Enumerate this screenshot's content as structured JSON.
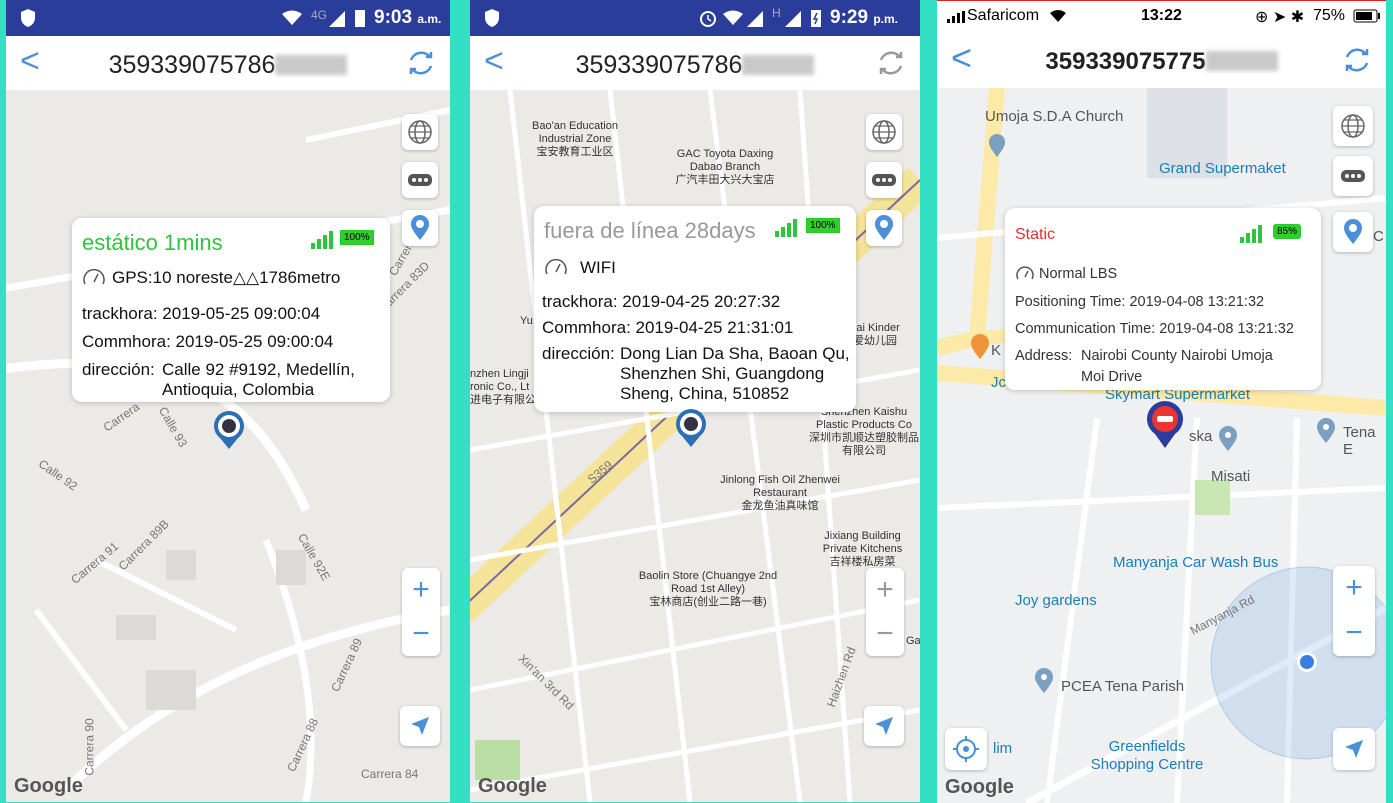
{
  "panels": [
    {
      "status": {
        "time": "9:03",
        "ampm": "a.m.",
        "network": "4G"
      },
      "header": {
        "back": "<",
        "title": "359339075786"
      },
      "popup": {
        "status": "estático 1mins",
        "battery": "100%",
        "line1": "GPS:10 noreste△△1786metro",
        "track": "trackhora: 2019-05-25 09:00:04",
        "comm": "Commhora: 2019-05-25 09:00:04",
        "addr_label": "dirección:",
        "addr_1": "Calle 92 #9192, Medellín,",
        "addr_2": "Antioquia, Colombia"
      },
      "streets": [
        "Carrera",
        "Calle 93",
        "Calle 92",
        "Carrera 91",
        "Carrera 89B",
        "Calle 92E",
        "Carrera 89",
        "Carrera 88",
        "Carrera 90",
        "Carrera 84",
        "Carrera 83D",
        "Carrera 84d"
      ],
      "google": "Google",
      "colors": {
        "status": "#2ec43c"
      }
    },
    {
      "status": {
        "time": "9:29",
        "ampm": "p.m.",
        "network": "H"
      },
      "header": {
        "back": "<",
        "title": "359339075786"
      },
      "popup": {
        "status": "fuera de línea 28days",
        "battery": "100%",
        "line1": "WIFI",
        "track": "trackhora: 2019-04-25 20:27:32",
        "comm": "Commhora: 2019-04-25 21:31:01",
        "addr_label": "dirección:",
        "addr_1": "Dong Lian Da Sha, Baoan Qu,",
        "addr_2": "Shenzhen Shi, Guangdong",
        "addr_3": "Sheng, China, 510852"
      },
      "places": {
        "baoan": "Bao'an Education Industrial Zone",
        "baoan_cn": "宝安教育工业区",
        "gac": "GAC Toyota Daxing Dabao Branch",
        "gac_cn": "广汽丰田大兴大宝店",
        "kinder": "ng'ai Kinder",
        "kinder_cn": "恒爱幼儿园",
        "lingji": "nzhen Lingji ronic Co., Lt",
        "lingji_cn": "进电子有限公司",
        "kaishu": "Shenzhen Kaishu Plastic Products Co",
        "kaishu_cn": "深圳市凯顺达塑胶制品有限公司",
        "jinlong": "Jinlong Fish Oil Zhenwei Restaurant",
        "jinlong_cn": "金龙鱼油真味馆",
        "jixiang": "Jixiang Building Private Kitchens",
        "jixiang_cn": "吉祥楼私房菜",
        "baolin": "Baolin Store (Chuangye 2nd Road 1st Alley)",
        "baolin_cn": "宝林商店(创业二路一巷)",
        "ga": "Ga",
        "road_s359": "S359",
        "xinan": "Xin'an 3rd Rd",
        "haizhen": "Haizhen Rd",
        "yu": "Yu"
      },
      "google": "Google",
      "colors": {
        "status": "#999999"
      }
    },
    {
      "status": {
        "carrier": "Safaricom",
        "time": "13:22",
        "battery": "75%"
      },
      "header": {
        "back": "<",
        "title": "359339075775"
      },
      "popup": {
        "status": "Static",
        "battery": "85%",
        "line1": "Normal  LBS",
        "track": "Positioning Time: 2019-04-08 13:21:32",
        "comm": "Communication Time: 2019-04-08 13:21:32",
        "addr_label": "Address:",
        "addr_1": "Nairobi County Nairobi Umoja",
        "addr_2": "Moi Drive"
      },
      "places": {
        "church": "Umoja S.D.A Church",
        "grand": "Grand Supermaket",
        "skymart": "Skymart Supermarket",
        "ska": "ska",
        "tena": "Tena E",
        "misati": "Misati",
        "manyanja_cw": "Manyanja Car Wash Bus",
        "joy": "Joy gardens",
        "manyanja_rd": "Manyanja Rd",
        "pcea": "PCEA Tena Parish",
        "greenfields": "Greenfields Shopping Centre",
        "lim": "lim",
        "k": "K",
        "jc": "Jc",
        "c": "C"
      },
      "google": "Google",
      "colors": {
        "status": "#e03030"
      }
    }
  ]
}
